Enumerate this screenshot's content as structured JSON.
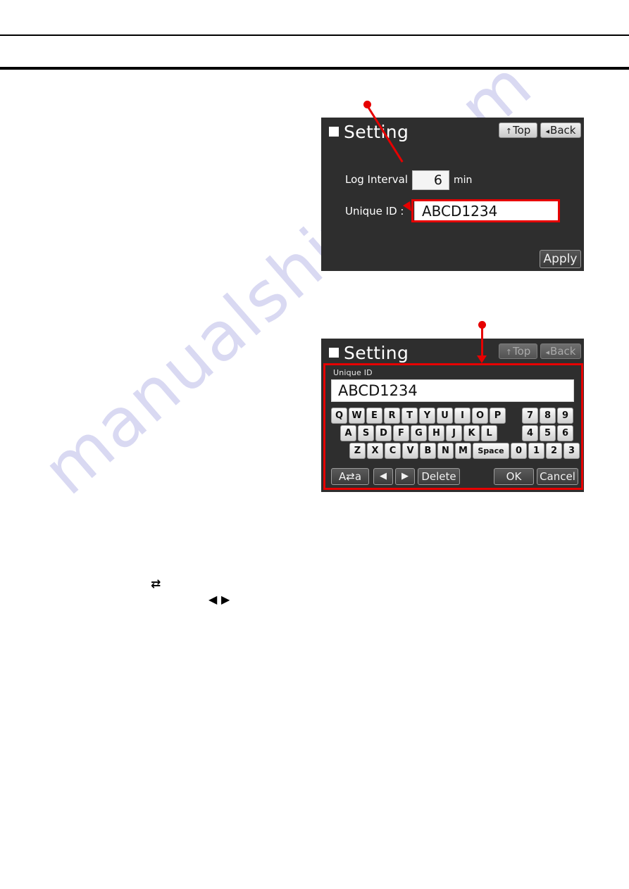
{
  "page": {
    "watermark": "manualshive.com"
  },
  "rules": {
    "thin": "horizontal-rule-thin",
    "thick": "horizontal-rule-thick"
  },
  "panel1": {
    "title": "Setting",
    "nav": {
      "top_label": "Top",
      "top_glyph": "↑",
      "back_label": "Back",
      "back_glyph": "◂"
    },
    "rows": [
      {
        "label": "Log Interval :",
        "value": "6",
        "unit": "min"
      },
      {
        "label": "Unique ID    :",
        "value": "ABCD1234",
        "unit": ""
      }
    ],
    "apply_label": "Apply"
  },
  "panel2": {
    "title": "Setting",
    "nav": {
      "top_label": "Top",
      "top_glyph": "↑",
      "back_label": "Back",
      "back_glyph": "◂"
    },
    "field_label": "Unique ID",
    "field_value": "ABCD1234",
    "keyboard": {
      "row1": [
        "Q",
        "W",
        "E",
        "R",
        "T",
        "Y",
        "U",
        "I",
        "O",
        "P"
      ],
      "row2": [
        "A",
        "S",
        "D",
        "F",
        "G",
        "H",
        "J",
        "K",
        "L"
      ],
      "row3": [
        "Z",
        "X",
        "C",
        "V",
        "B",
        "N",
        "M"
      ],
      "space_label": "Space",
      "row3_numbers": [
        "0",
        "1",
        "2",
        "3"
      ],
      "numpad_row1": [
        "7",
        "8",
        "9"
      ],
      "numpad_row2": [
        "4",
        "5",
        "6"
      ],
      "function_row": {
        "case_toggle": "A⇄a",
        "left_label": "◀",
        "right_label": "▶",
        "delete_label": "Delete",
        "ok_label": "OK",
        "cancel_label": "Cancel"
      }
    }
  },
  "body_icons": {
    "swap_glyph": "⇄",
    "left_glyph": "◀",
    "right_glyph": "▶"
  },
  "colors": {
    "panel_bg": "#2e2e2e",
    "callout_red": "#e60000",
    "key_face": "#e8e8e8",
    "watermark": "#d9d9f2"
  }
}
